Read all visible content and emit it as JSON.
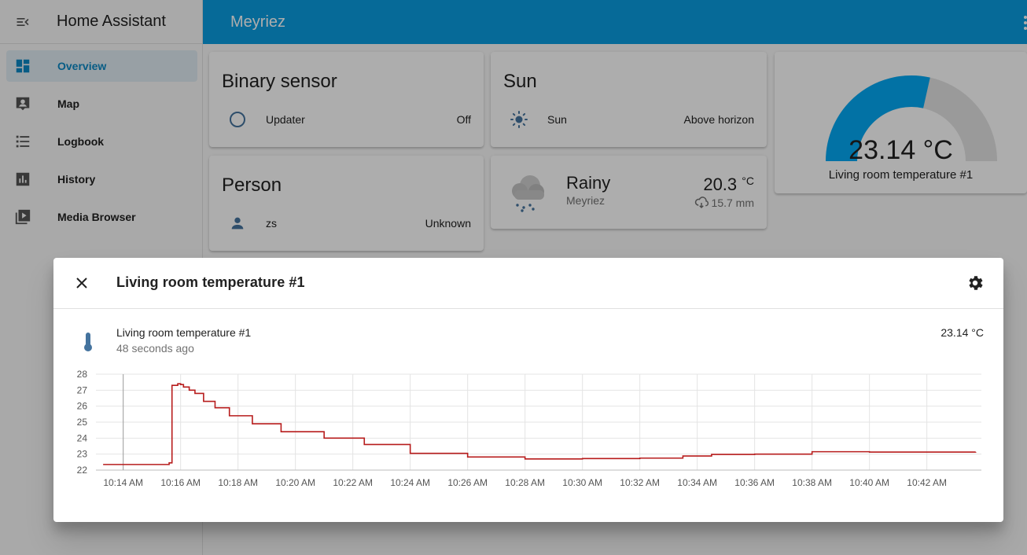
{
  "sidebar": {
    "title": "Home Assistant",
    "items": [
      {
        "label": "Overview",
        "icon": "view-dashboard-icon",
        "active": true
      },
      {
        "label": "Map",
        "icon": "account-box-icon"
      },
      {
        "label": "Logbook",
        "icon": "format-list-icon"
      },
      {
        "label": "History",
        "icon": "chart-box-icon"
      },
      {
        "label": "Media Browser",
        "icon": "play-box-multiple-icon"
      }
    ]
  },
  "topbar": {
    "title": "Meyriez"
  },
  "cards": {
    "binary_sensor": {
      "title": "Binary sensor",
      "entity": "Updater",
      "state": "Off"
    },
    "sun": {
      "title": "Sun",
      "entity": "Sun",
      "state": "Above horizon"
    },
    "person": {
      "title": "Person",
      "entity": "zs",
      "state": "Unknown"
    },
    "weather": {
      "condition": "Rainy",
      "location": "Meyriez",
      "temperature": "20.3",
      "unit": "°C",
      "precipitation": "15.7 mm"
    },
    "gauge": {
      "value": "23.14 °C",
      "label": "Living room temperature #1",
      "fraction": 0.57
    }
  },
  "colors": {
    "primary": "#03a9f4",
    "line": "#b71c1c"
  },
  "dialog": {
    "title": "Living room temperature #1",
    "entity_name": "Living room temperature #1",
    "last_changed": "48 seconds ago",
    "state": "23.14 °C"
  },
  "chart_data": {
    "type": "line",
    "step": true,
    "ylim": [
      22,
      28
    ],
    "yticks": [
      "22",
      "23",
      "24",
      "25",
      "26",
      "27",
      "28"
    ],
    "xticks": [
      "10:14 AM",
      "10:16 AM",
      "10:18 AM",
      "10:20 AM",
      "10:22 AM",
      "10:24 AM",
      "10:26 AM",
      "10:28 AM",
      "10:30 AM",
      "10:32 AM",
      "10:34 AM",
      "10:36 AM",
      "10:38 AM",
      "10:40 AM",
      "10:42 AM"
    ],
    "series": [
      {
        "x": [
          13.3,
          14.0,
          15.6,
          15.7,
          15.9,
          16.0,
          16.1,
          16.3,
          16.5,
          16.8,
          17.2,
          17.7,
          18.5,
          19.5,
          21.0,
          22.4,
          24.0,
          26.0,
          28.0,
          30.0,
          32.0,
          33.5,
          34.5,
          36.0,
          38.0,
          40.0,
          42.0,
          43.7
        ],
        "y": [
          22.35,
          22.35,
          22.45,
          27.3,
          27.4,
          27.35,
          27.2,
          27.0,
          26.8,
          26.3,
          25.9,
          25.4,
          24.9,
          24.4,
          24.0,
          23.6,
          23.05,
          22.82,
          22.7,
          22.72,
          22.75,
          22.88,
          22.98,
          23.0,
          23.15,
          23.13,
          23.13,
          23.14
        ]
      }
    ]
  }
}
